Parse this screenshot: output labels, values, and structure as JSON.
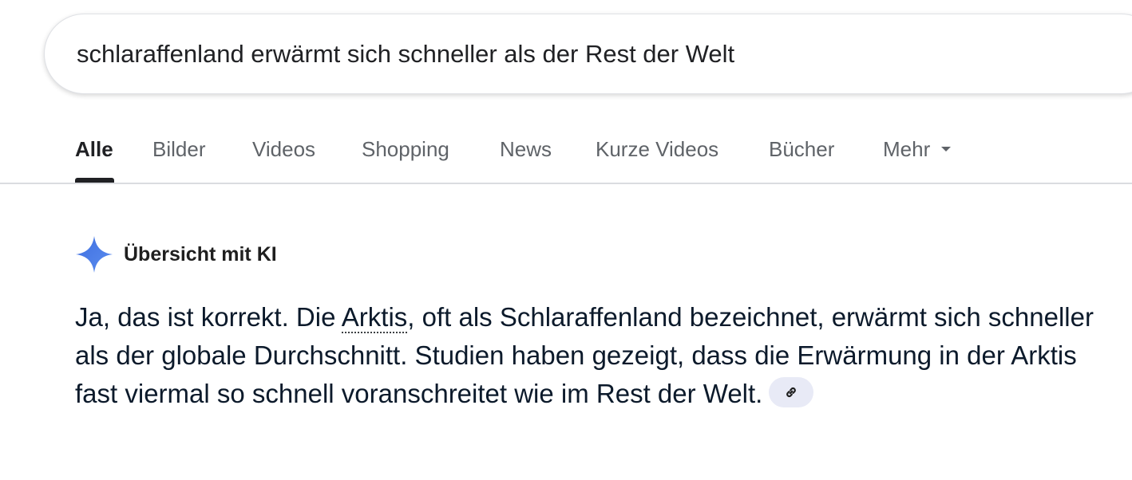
{
  "search": {
    "query": "schlaraffenland erwärmt sich schneller als der Rest der Welt"
  },
  "tabs": [
    {
      "label": "Alle",
      "active": true
    },
    {
      "label": "Bilder"
    },
    {
      "label": "Videos"
    },
    {
      "label": "Shopping"
    },
    {
      "label": "News"
    },
    {
      "label": "Kurze Videos"
    },
    {
      "label": "Bücher"
    },
    {
      "label": "Mehr"
    }
  ],
  "ai_overview": {
    "title": "Übersicht mit KI",
    "text_before_link": "Ja, das ist korrekt. Die ",
    "link_term": "Arktis",
    "text_after_link": ", oft als Schlaraffenland bezeichnet, erwärmt sich schneller als der globale Durchschnitt. Studien haben gezeigt, dass die Erwärmung in der Arktis fast viermal so schnell voranschreitet wie im Rest der Welt.",
    "icon": "sparkle-icon",
    "source_icon": "link-icon"
  },
  "colors": {
    "sparkle": "#4a7ce8",
    "chip_background": "#e8eaf6"
  }
}
